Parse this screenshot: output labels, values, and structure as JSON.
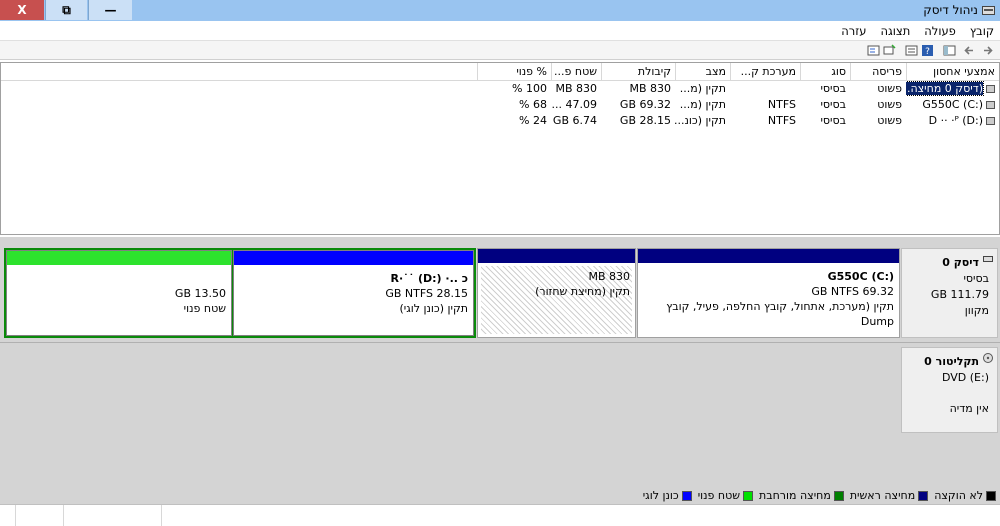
{
  "window": {
    "title": "ניהול דיסק",
    "close_label": "X",
    "restore_label": "⧉",
    "minimize_label": "—"
  },
  "menu": [
    "קובץ",
    "פעולה",
    "תצוגה",
    "עזרה"
  ],
  "table": {
    "headers": [
      "אמצעי אחסון",
      "פריסה",
      "סוג",
      "מערכת ק...",
      "מצב",
      "קיבולת",
      "שטח פ...",
      "% פנוי"
    ],
    "rows": [
      {
        "volume": "(דיסק 0 מחיצה...",
        "layout": "פשוט",
        "type": "בסיסי",
        "fs": "",
        "status": "תקין (מ...",
        "capacity": "830 MB",
        "free": "830 MB",
        "pct": "100 %"
      },
      {
        "volume": "G550C (C:)",
        "layout": "פשוט",
        "type": "בסיסי",
        "fs": "NTFS",
        "status": "תקין (מ...",
        "capacity": "69.32 GB",
        "free": "47.09 ...",
        "pct": "68 %"
      },
      {
        "volume": "D ·· ·ᴾ (D:)",
        "layout": "פשוט",
        "type": "בסיסי",
        "fs": "NTFS",
        "status": "תקין (כונ...",
        "capacity": "28.15 GB",
        "free": "6.74 GB",
        "pct": "24 %"
      }
    ]
  },
  "disk0": {
    "name": "דיסק 0",
    "type": "בסיסי",
    "size": "111.79 GB",
    "status": "מקוון",
    "partitions": {
      "c": {
        "title": "G550C  (C:)",
        "size": "69.32 GB NTFS",
        "status": "תקין (מערכת, אתחול, קובץ החלפה, פעיל, קובץ Dump"
      },
      "recovery": {
        "size": "830 MB",
        "status": "תקין (מחיצת שחזור)"
      },
      "d": {
        "title": "כ ..· R·˙˙ (D:)",
        "size": "28.15 GB NTFS",
        "status": "תקין (כונן לוגי)"
      },
      "free": {
        "size": "13.50 GB",
        "status": "שטח פנוי"
      }
    }
  },
  "cdrom0": {
    "name": "תקליטור 0",
    "type": "DVD (E:)",
    "status": "אין מדיה"
  },
  "legend": [
    {
      "label": "לא הוקצה",
      "color": "#000000"
    },
    {
      "label": "מחיצה ראשית",
      "color": "#000080"
    },
    {
      "label": "מחיצה מורחבת",
      "color": "#008000"
    },
    {
      "label": "שטח פנוי",
      "color": "#00e000"
    },
    {
      "label": "כונן לוגי",
      "color": "#0000ff"
    }
  ]
}
